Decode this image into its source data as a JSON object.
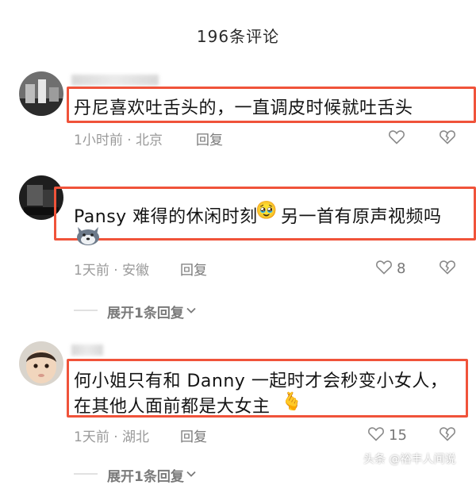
{
  "header": {
    "title": "196条评论"
  },
  "comments": [
    {
      "text_lines": [
        "丹尼喜欢吐舌头的，一直调皮时候就吐舌头"
      ],
      "meta": "1小时前 · 北京",
      "reply_label": "回复",
      "like_count": ""
    },
    {
      "text_lines": [
        "Pansy 难得的休闲时刻",
        "另一首有原声视频吗"
      ],
      "emoji_inline": "🥹",
      "meta": "1天前 · 安徽",
      "reply_label": "回复",
      "like_count": "8",
      "expand_label": "展开1条回复"
    },
    {
      "text_lines": [
        "何小姐只有和 Danny 一起时才会秒变小女人，",
        "在其他人面前都是大女主"
      ],
      "emoji_inline": "🫰",
      "meta": "1天前 · 湖北",
      "reply_label": "回复",
      "like_count": "15",
      "expand_label": "展开1条回复"
    }
  ],
  "watermark": "头条 @裕丰人间说",
  "colors": {
    "highlight": "#f0533a",
    "meta": "#9a9a9a",
    "text": "#141414"
  },
  "icons": [
    "heart-outline-icon",
    "broken-heart-icon",
    "chevron-down-icon",
    "dog-sticker-icon"
  ]
}
